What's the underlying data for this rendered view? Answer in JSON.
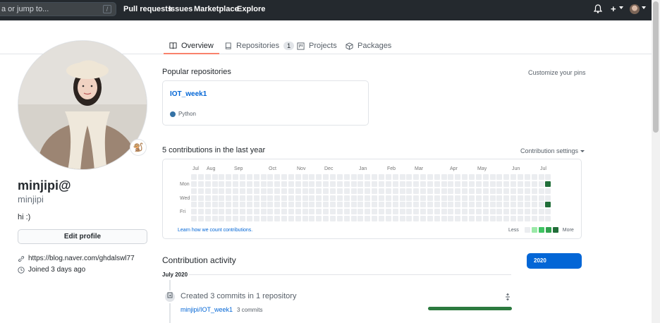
{
  "header": {
    "search_placeholder": "a or jump to...",
    "slash_key": "/",
    "nav": [
      "Pull requests",
      "Issues",
      "Marketplace",
      "Explore"
    ],
    "plus_glyph": "+"
  },
  "tabs": [
    {
      "label": "Overview",
      "icon": "book-icon",
      "selected": true
    },
    {
      "label": "Repositories",
      "icon": "repo-icon",
      "counter": "1"
    },
    {
      "label": "Projects",
      "icon": "project-icon"
    },
    {
      "label": "Packages",
      "icon": "package-icon"
    }
  ],
  "profile": {
    "name": "minjipi@",
    "login": "minjipi",
    "bio": "hi :)",
    "edit_label": "Edit profile",
    "website": "https://blog.naver.com/ghdalswl77",
    "joined": "Joined 3 days ago",
    "status_icon": "emoji-icon"
  },
  "popular": {
    "title": "Popular repositories",
    "customize": "Customize your pins",
    "repo": {
      "name": "IOT_week1",
      "language": "Python",
      "language_color": "#3572A5"
    }
  },
  "contributions": {
    "title": "5 contributions in the last year",
    "settings": "Contribution settings",
    "months": [
      "Jul",
      "Aug",
      "Sep",
      "Oct",
      "Nov",
      "Dec",
      "Jan",
      "Feb",
      "Mar",
      "Apr",
      "May",
      "Jun",
      "Jul"
    ],
    "weekdays": [
      "Mon",
      "Wed",
      "Fri"
    ],
    "learn": "Learn how we count contributions.",
    "less": "Less",
    "more": "More",
    "colors": [
      "#ebedf0",
      "#9be9a8",
      "#40c463",
      "#30a14e",
      "#216e39"
    ],
    "active_days": [
      {
        "week": 51,
        "weekday": 1,
        "level": 4
      },
      {
        "week": 51,
        "weekday": 4,
        "level": 4
      }
    ]
  },
  "activity": {
    "title": "Contribution activity",
    "year": "2020",
    "month": "July 2020",
    "event": "Created 3 commits in 1 repository",
    "repo": "minjipi/IOT_week1",
    "commits": "3 commits",
    "progress": 1.0,
    "progress_color": "#2c7a3f"
  }
}
